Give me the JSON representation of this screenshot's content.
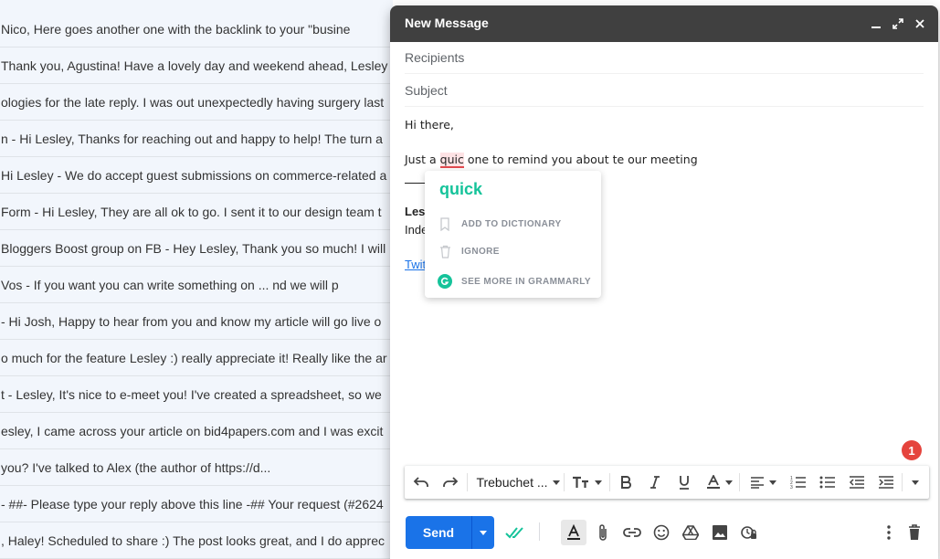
{
  "inbox": {
    "rows": [
      " Nico, Here goes another one with the backlink to your \"busine",
      "Thank you, Agustina! Have a lovely day and weekend ahead, Lesley",
      "ologies for the late reply. I was out unexpectedly having surgery last",
      "n - Hi Lesley, Thanks for reaching out and happy to help! The turn a",
      "Hi Lesley - We do accept guest submissions on commerce-related a",
      " Form - Hi Lesley, They are all ok to go. I sent it to our design team t",
      " Bloggers Boost group on FB - Hey Lesley, Thank you so much! I will",
      " Vos - If you want you can write something on ... nd we will p",
      " - Hi Josh, Happy to hear from you and know my article will go live o",
      "o much for the feature Lesley :) really appreciate it! Really like the ar",
      "t - Lesley, It's nice to e-meet you! I've created a spreadsheet, so we",
      "esley, I came across your article on bid4papers.com and I was excit",
      "you? I've talked to Alex (the author of https://d...",
      " - ##- Please type your reply above this line -## Your request (#2624",
      ", Haley! Scheduled to share :) The post looks great, and I do apprec"
    ]
  },
  "compose": {
    "title": "New Message",
    "recipients_placeholder": "Recipients",
    "subject_placeholder": "Subject",
    "greeting": "Hi there,",
    "line2_before": "Just a ",
    "line2_misspelled": "quic",
    "line2_after": " one to remind you about te our meeting",
    "signature_name": "Les",
    "signature_sub": "Inde",
    "signature_link": "Twit"
  },
  "grammarly": {
    "suggestion": "quick",
    "items": [
      {
        "label": "ADD TO DICTIONARY",
        "icon": "bookmark-icon"
      },
      {
        "label": "IGNORE",
        "icon": "trash-icon"
      },
      {
        "label": "SEE MORE IN GRAMMARLY",
        "icon": "grammarly-logo-icon"
      }
    ],
    "brand_color": "#15c39a"
  },
  "toolbar": {
    "font_name": "Trebuchet ...",
    "notification_count": "1"
  },
  "bottom": {
    "send_label": "Send"
  },
  "colors": {
    "accent": "#1a73e8",
    "header": "#404040",
    "badge": "#e5443d",
    "misspell": "#e34a4f"
  }
}
